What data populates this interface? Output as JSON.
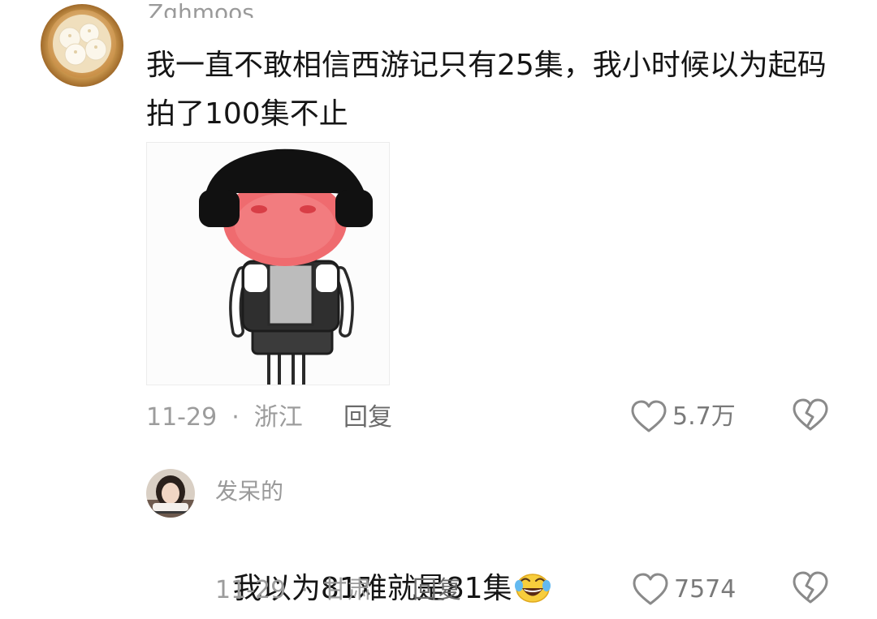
{
  "comment": {
    "username": "Zghmoos",
    "text": "我一直不敢相信西游记只有25集，我小时候以为起码拍了100集不止",
    "date": "11-29",
    "separator": "·",
    "location": "浙江",
    "reply_label": "回复",
    "like_count": "5.7万",
    "avatar_icon": "steamed-buns-basket",
    "image_icon": "cartoon-boy-meme"
  },
  "reply": {
    "username": "发呆的",
    "text": "我以为81难就是81集",
    "emoji_icon": "crying-laughing-face",
    "date": "11-29",
    "separator": "·",
    "location": "甘肃",
    "reply_label": "回复",
    "like_count": "7574",
    "avatar_icon": "girl-portrait"
  },
  "colors": {
    "meta_text": "#9c9c9c",
    "body_text": "#151515",
    "icon_stroke": "#8a8a8a"
  }
}
